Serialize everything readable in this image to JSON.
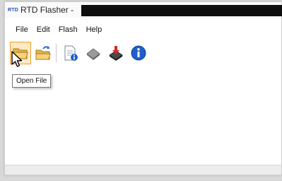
{
  "window": {
    "app_logo": "RTD",
    "title": "RTD Flasher -"
  },
  "menu": [
    {
      "label": "File"
    },
    {
      "label": "Edit"
    },
    {
      "label": "Flash"
    },
    {
      "label": "Help"
    }
  ],
  "toolbar": {
    "buttons": [
      {
        "icon": "open-folder-icon",
        "state": "hovered"
      },
      {
        "icon": "reload-folder-icon"
      },
      {
        "icon": "file-info-icon"
      },
      {
        "icon": "erase-chip-icon"
      },
      {
        "icon": "flash-chip-icon"
      },
      {
        "icon": "info-icon"
      }
    ]
  },
  "tooltip": {
    "text": "Open File"
  },
  "colors": {
    "accent": "#1f4fbf",
    "hover_border": "#f0a030",
    "hover_fill": "#fde9c4",
    "title_redaction": "#0e0e0e"
  }
}
